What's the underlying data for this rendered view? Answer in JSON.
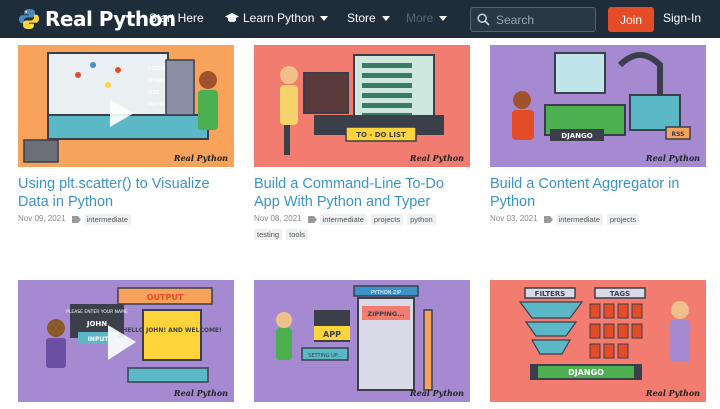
{
  "nav": {
    "logo_text": "Real Python",
    "items": [
      {
        "label": "Start Here"
      },
      {
        "label": "Learn Python"
      },
      {
        "label": "Store"
      },
      {
        "label": "More"
      }
    ],
    "search_placeholder": "Search",
    "join_label": "Join",
    "signin_label": "Sign-In"
  },
  "cards": [
    {
      "title": "Using plt.scatter() to Visualize Data in Python",
      "date": "Nov 09, 2021",
      "tags": [
        "intermediate"
      ],
      "bg": "#f7a35c",
      "image_text": [
        "COLOR",
        "SHAPE",
        "SIZE",
        "ALPHA"
      ]
    },
    {
      "title": "Build a Command-Line To-Do App With Python and Typer",
      "date": "Nov 08, 2021",
      "tags": [
        "intermediate",
        "projects",
        "python",
        "testing",
        "tools"
      ],
      "bg": "#f27c6f",
      "image_text": [
        "TO - DO LIST"
      ]
    },
    {
      "title": "Build a Content Aggregator in Python",
      "date": "Nov 03, 2021",
      "tags": [
        "intermediate",
        "projects"
      ],
      "bg": "#a58ad1",
      "image_text": [
        "DJANGO",
        "RSS"
      ]
    },
    {
      "title": "",
      "date": "",
      "tags": [],
      "bg": "#a58ad1",
      "image_text": [
        "OUTPUT",
        "PLEASE ENTER YOUR NAME",
        "JOHN",
        "INPUT",
        "HELLO JOHN! AND WELCOME!"
      ]
    },
    {
      "title": "",
      "date": "",
      "tags": [],
      "bg": "#a58ad1",
      "image_text": [
        "PYTHON ZIP",
        "ZIPPING...",
        "APP",
        "SETTING UP..."
      ]
    },
    {
      "title": "",
      "date": "",
      "tags": [],
      "bg": "#f27c6f",
      "image_text": [
        "FILTERS",
        "TAGS",
        "DJANGO"
      ]
    }
  ],
  "brand_text": "Real Python"
}
